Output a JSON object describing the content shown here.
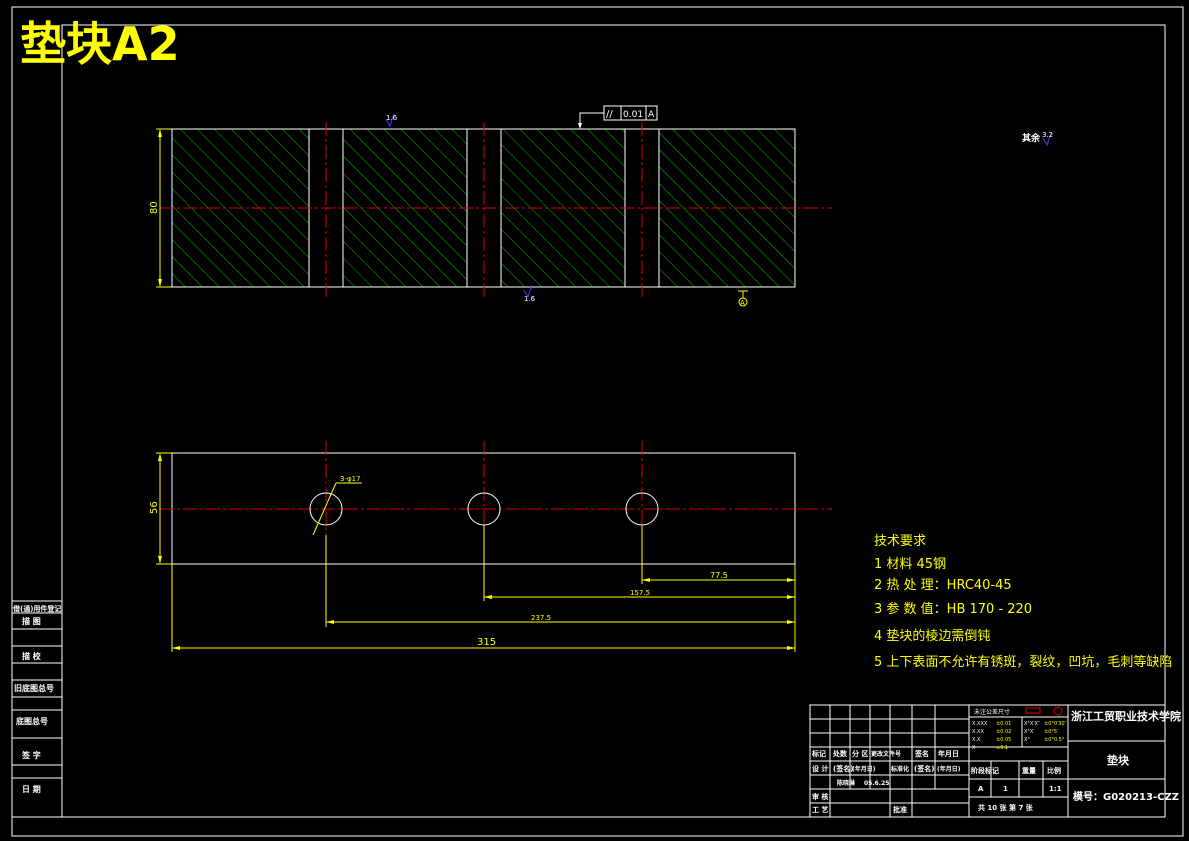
{
  "drawing": {
    "title": "垫块A2",
    "roughness_top": "1.6",
    "roughness_bottom": "1.6",
    "roughness_rest_label": "其余",
    "roughness_rest_value": "3.2",
    "tolerance_symbol": "//",
    "tolerance_value": "0.01",
    "datum": "A",
    "datum_bottom": "A"
  },
  "dimensions": {
    "front_height": "80",
    "plan_height": "56",
    "hole_callout": "3-φ17",
    "d1": "77.5",
    "d2": "157.5",
    "d3": "237.5",
    "overall": "315"
  },
  "tech_requirements": {
    "heading": "技术要求",
    "items": [
      "1 材料 45钢",
      "2 热 处 理：HRC40-45",
      "3 参 数 值：HB 170 - 220",
      "4 垫块的棱边需倒钝",
      "5 上下表面不允许有锈斑，裂纹，凹坑，毛刺等缺陷"
    ]
  },
  "side_table": {
    "rows": [
      "借(通)用件登记",
      "描 图",
      "描 校",
      "旧底图总号",
      "底图总号",
      "签 字",
      "日 期"
    ]
  },
  "title_block": {
    "school": "浙江工贸职业技术学院",
    "part_name": "垫块",
    "drawing_no": "模号：G020213-CZZ",
    "tolerance_header": "未注公差尺寸",
    "tol_rows": [
      [
        "X.XXX",
        "±0.01",
        "X°X′X″",
        "±0°0′30″"
      ],
      [
        "X.XX",
        "±0.02",
        "X°X′",
        "±0°5′"
      ],
      [
        "X.X",
        "±0.05",
        "X°",
        "±0°0.5°"
      ],
      [
        "X",
        "±0.1",
        "",
        ""
      ]
    ],
    "col_labels": [
      "标记",
      "处数",
      "分 区",
      "更改文件号",
      "签名",
      "年月日"
    ],
    "design_row": [
      "设 计",
      "(签名)",
      "(年月日)",
      "标准化",
      "(签名)",
      "(年月日)"
    ],
    "check_row": [
      "",
      "",
      "陈晓琳",
      "05.6.25"
    ],
    "review": "审 核",
    "process": "工 艺",
    "approve": "批准",
    "stage_labels": [
      "阶段标记",
      "重量",
      "比例"
    ],
    "stage_values": [
      "A",
      "1",
      "1:1"
    ],
    "sheet_info": "共 10 张   第 7 张"
  }
}
